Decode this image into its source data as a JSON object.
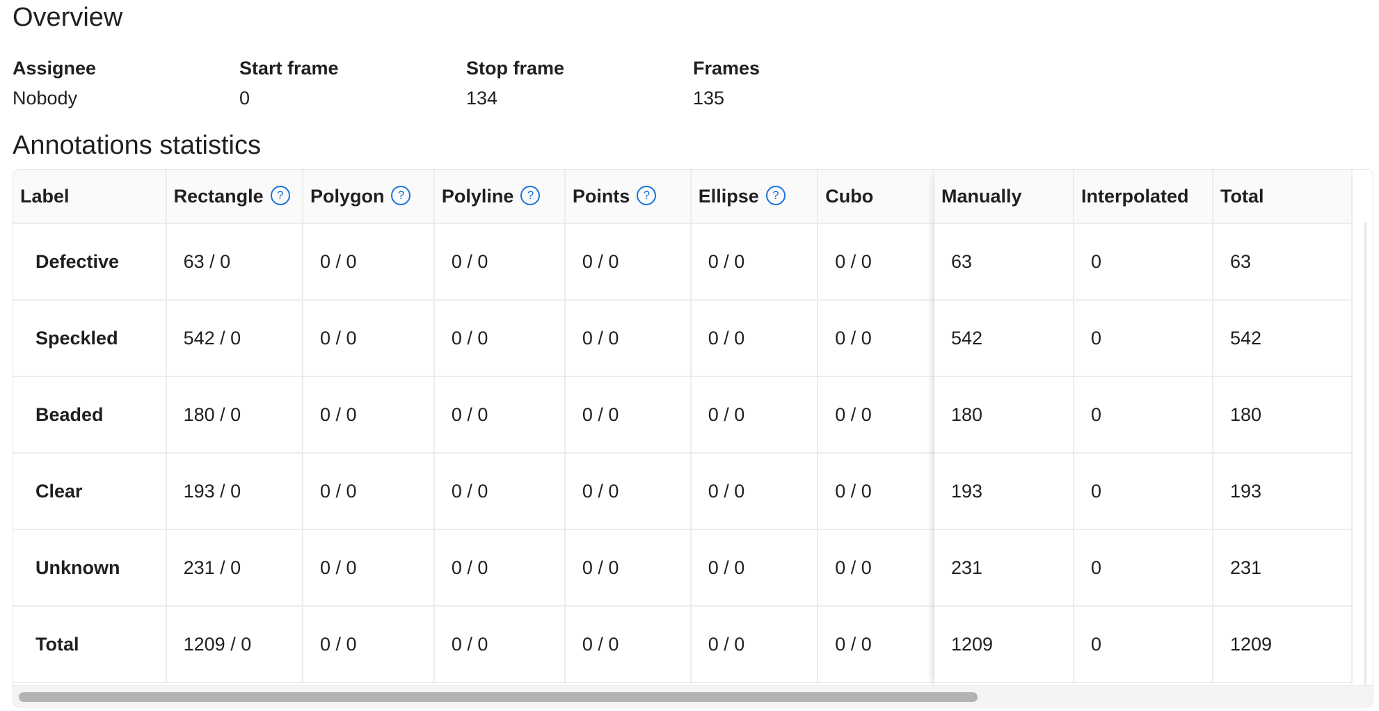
{
  "overview": {
    "title": "Overview",
    "fields": [
      {
        "label": "Assignee",
        "value": "Nobody"
      },
      {
        "label": "Start frame",
        "value": "0"
      },
      {
        "label": "Stop frame",
        "value": "134"
      },
      {
        "label": "Frames",
        "value": "135"
      }
    ]
  },
  "stats": {
    "title": "Annotations statistics",
    "columns": {
      "label": "Label",
      "rectangle": "Rectangle",
      "polygon": "Polygon",
      "polyline": "Polyline",
      "points": "Points",
      "ellipse": "Ellipse",
      "cuboid": "Cubo",
      "manually": "Manually",
      "interpolated": "Interpolated",
      "total": "Total"
    },
    "help_icon": "?",
    "rows": [
      {
        "label": "Defective",
        "rectangle": "63 / 0",
        "polygon": "0 / 0",
        "polyline": "0 / 0",
        "points": "0 / 0",
        "ellipse": "0 / 0",
        "cuboid": "0 / 0",
        "manually": "63",
        "interpolated": "0",
        "total": "63"
      },
      {
        "label": "Speckled",
        "rectangle": "542 / 0",
        "polygon": "0 / 0",
        "polyline": "0 / 0",
        "points": "0 / 0",
        "ellipse": "0 / 0",
        "cuboid": "0 / 0",
        "manually": "542",
        "interpolated": "0",
        "total": "542"
      },
      {
        "label": "Beaded",
        "rectangle": "180 / 0",
        "polygon": "0 / 0",
        "polyline": "0 / 0",
        "points": "0 / 0",
        "ellipse": "0 / 0",
        "cuboid": "0 / 0",
        "manually": "180",
        "interpolated": "0",
        "total": "180"
      },
      {
        "label": "Clear",
        "rectangle": "193 / 0",
        "polygon": "0 / 0",
        "polyline": "0 / 0",
        "points": "0 / 0",
        "ellipse": "0 / 0",
        "cuboid": "0 / 0",
        "manually": "193",
        "interpolated": "0",
        "total": "193"
      },
      {
        "label": "Unknown",
        "rectangle": "231 / 0",
        "polygon": "0 / 0",
        "polyline": "0 / 0",
        "points": "0 / 0",
        "ellipse": "0 / 0",
        "cuboid": "0 / 0",
        "manually": "231",
        "interpolated": "0",
        "total": "231"
      },
      {
        "label": "Total",
        "rectangle": "1209 / 0",
        "polygon": "0 / 0",
        "polyline": "0 / 0",
        "points": "0 / 0",
        "ellipse": "0 / 0",
        "cuboid": "0 / 0",
        "manually": "1209",
        "interpolated": "0",
        "total": "1209"
      }
    ]
  },
  "colors": {
    "accent": "#1a73d9",
    "header_bg": "#fafafa",
    "border": "#ececec",
    "scrollbar_thumb": "#b3b3b3"
  }
}
